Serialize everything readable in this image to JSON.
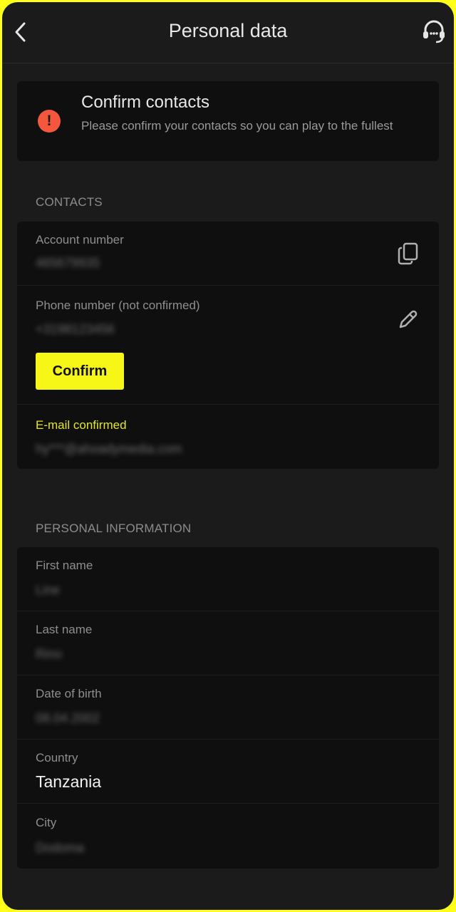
{
  "header": {
    "title": "Personal data",
    "back_icon": "chevron-left-icon",
    "support_icon": "headset-icon"
  },
  "alert": {
    "icon": "exclamation-circle-icon",
    "title": "Confirm contacts",
    "text": "Please confirm your contacts so you can play to the fullest"
  },
  "contacts": {
    "section_label": "CONTACTS",
    "account": {
      "label": "Account number",
      "value": "465679935",
      "icon": "copy-icon"
    },
    "phone": {
      "label": "Phone number (not confirmed)",
      "value": "+3198123456",
      "icon": "pencil-icon",
      "confirm_label": "Confirm"
    },
    "email": {
      "label": "E-mail confirmed",
      "value": "hy***@ahoadymedia.com"
    }
  },
  "personal": {
    "section_label": "PERSONAL INFORMATION",
    "first_name": {
      "label": "First name",
      "value": "Line"
    },
    "last_name": {
      "label": "Last name",
      "value": "Rino"
    },
    "dob": {
      "label": "Date of birth",
      "value": "08.04.2002"
    },
    "country": {
      "label": "Country",
      "value": "Tanzania"
    },
    "city": {
      "label": "City",
      "value": "Dodoma"
    }
  },
  "colors": {
    "accent": "#f6f617",
    "alert": "#f4573e",
    "background": "#1b1b1b",
    "card": "#0f0f0f"
  }
}
